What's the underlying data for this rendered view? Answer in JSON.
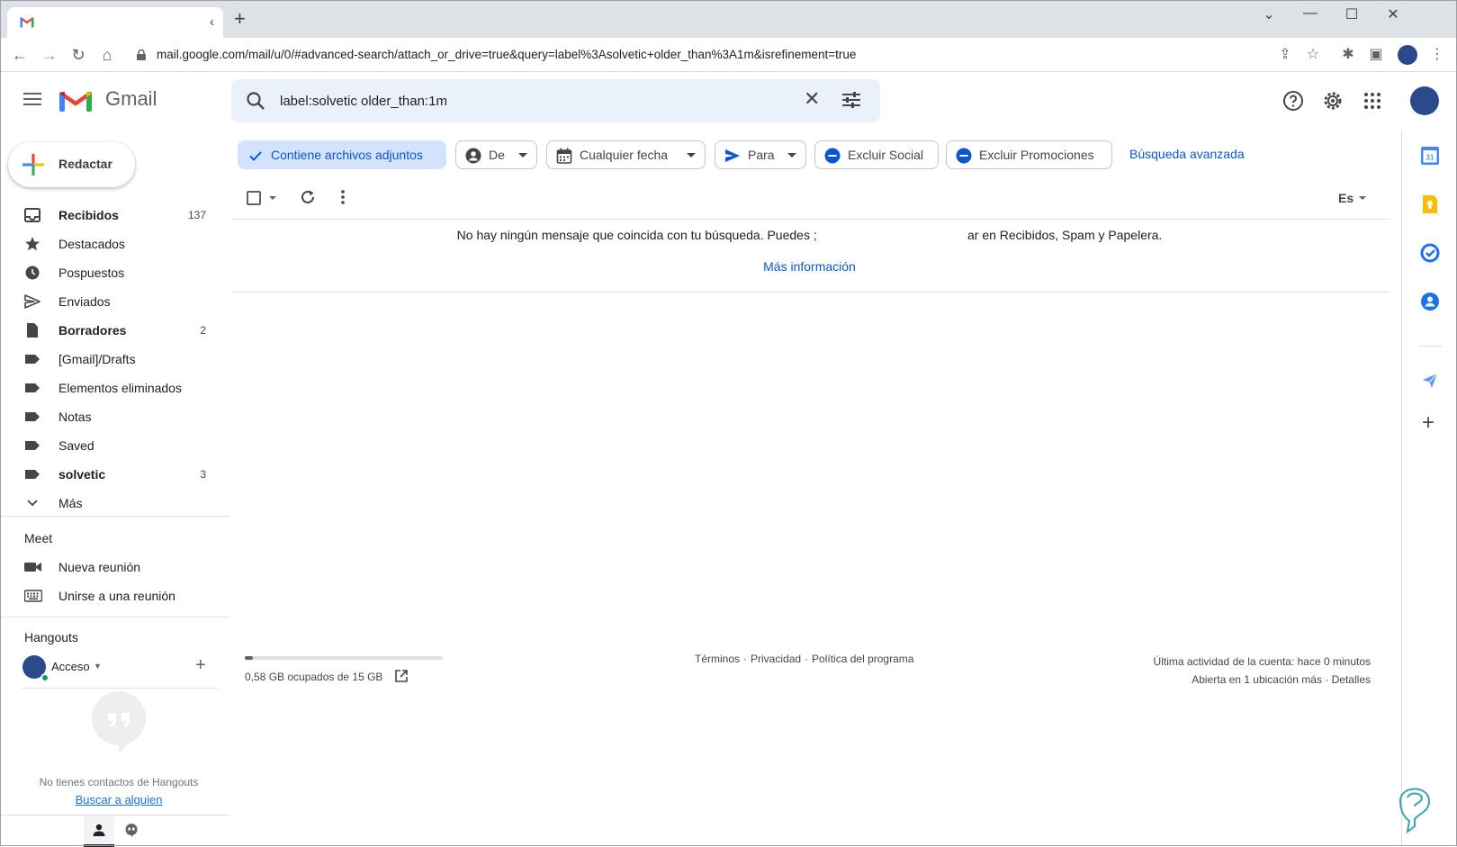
{
  "browser": {
    "address_url": "mail.google.com/mail/u/0/#advanced-search/attach_or_drive=true&query=label%3Asolvetic+older_than%3A1m&isrefinement=true",
    "new_tab_label": "+"
  },
  "header": {
    "app_name": "Gmail",
    "search_query": "label:solvetic older_than:1m"
  },
  "sidebar": {
    "compose_label": "Redactar",
    "items": [
      {
        "label": "Recibidos",
        "count": "137",
        "bold": true,
        "icon": "inbox-icon"
      },
      {
        "label": "Destacados",
        "count": "",
        "bold": false,
        "icon": "star-icon"
      },
      {
        "label": "Pospuestos",
        "count": "",
        "bold": false,
        "icon": "clock-icon"
      },
      {
        "label": "Enviados",
        "count": "",
        "bold": false,
        "icon": "send-icon"
      },
      {
        "label": "Borradores",
        "count": "2",
        "bold": true,
        "icon": "draft-icon"
      },
      {
        "label": "[Gmail]/Drafts",
        "count": "",
        "bold": false,
        "icon": "label-icon"
      },
      {
        "label": "Elementos eliminados",
        "count": "",
        "bold": false,
        "icon": "label-icon"
      },
      {
        "label": "Notas",
        "count": "",
        "bold": false,
        "icon": "label-icon"
      },
      {
        "label": "Saved",
        "count": "",
        "bold": false,
        "icon": "label-icon"
      },
      {
        "label": "solvetic",
        "count": "3",
        "bold": true,
        "icon": "label-icon"
      },
      {
        "label": "Más",
        "count": "",
        "bold": false,
        "icon": "chevron-down-icon"
      }
    ],
    "meet": {
      "title": "Meet",
      "new_meeting": "Nueva reunión",
      "join_meeting": "Unirse a una reunión"
    },
    "hangouts": {
      "title": "Hangouts",
      "user_name": "Acceso",
      "empty_text": "No tienes contactos de Hangouts",
      "find_link": "Buscar a alguien"
    }
  },
  "filters": {
    "chips": [
      {
        "label": "Contiene archivos adjuntos",
        "selected": true,
        "icon": "check-icon",
        "caret": false
      },
      {
        "label": "De",
        "selected": false,
        "icon": "person-icon",
        "caret": true
      },
      {
        "label": "Cualquier fecha",
        "selected": false,
        "icon": "calendar-icon",
        "caret": true
      },
      {
        "label": "Para",
        "selected": false,
        "icon": "send-icon",
        "caret": true
      },
      {
        "label": "Excluir Social",
        "selected": false,
        "icon": "minus-circle-icon",
        "caret": false
      },
      {
        "label": "Excluir Promociones",
        "selected": false,
        "icon": "minus-circle-icon",
        "caret": false
      }
    ],
    "advanced_link": "Búsqueda avanzada"
  },
  "toolbar": {
    "language": "Es"
  },
  "results": {
    "empty_message": "No hay ningún mensaje que coincida con tu búsqueda. Puedes ;                                           ar en Recibidos, Spam y Papelera.",
    "more_info": "Más información"
  },
  "footer": {
    "storage_text": "0,58 GB ocupados de 15 GB",
    "storage_fraction": 0.039,
    "links": [
      "Términos",
      "Privacidad",
      "Política del programa"
    ],
    "activity_line1": "Última actividad de la cuenta: hace 0 minutos",
    "activity_line2": "Abierta en 1 ubicación más · Detalles"
  },
  "colors": {
    "accent_blue": "#0b57d0",
    "search_bg": "#eaf1fb",
    "chip_selected_bg": "#d3e3fd"
  }
}
